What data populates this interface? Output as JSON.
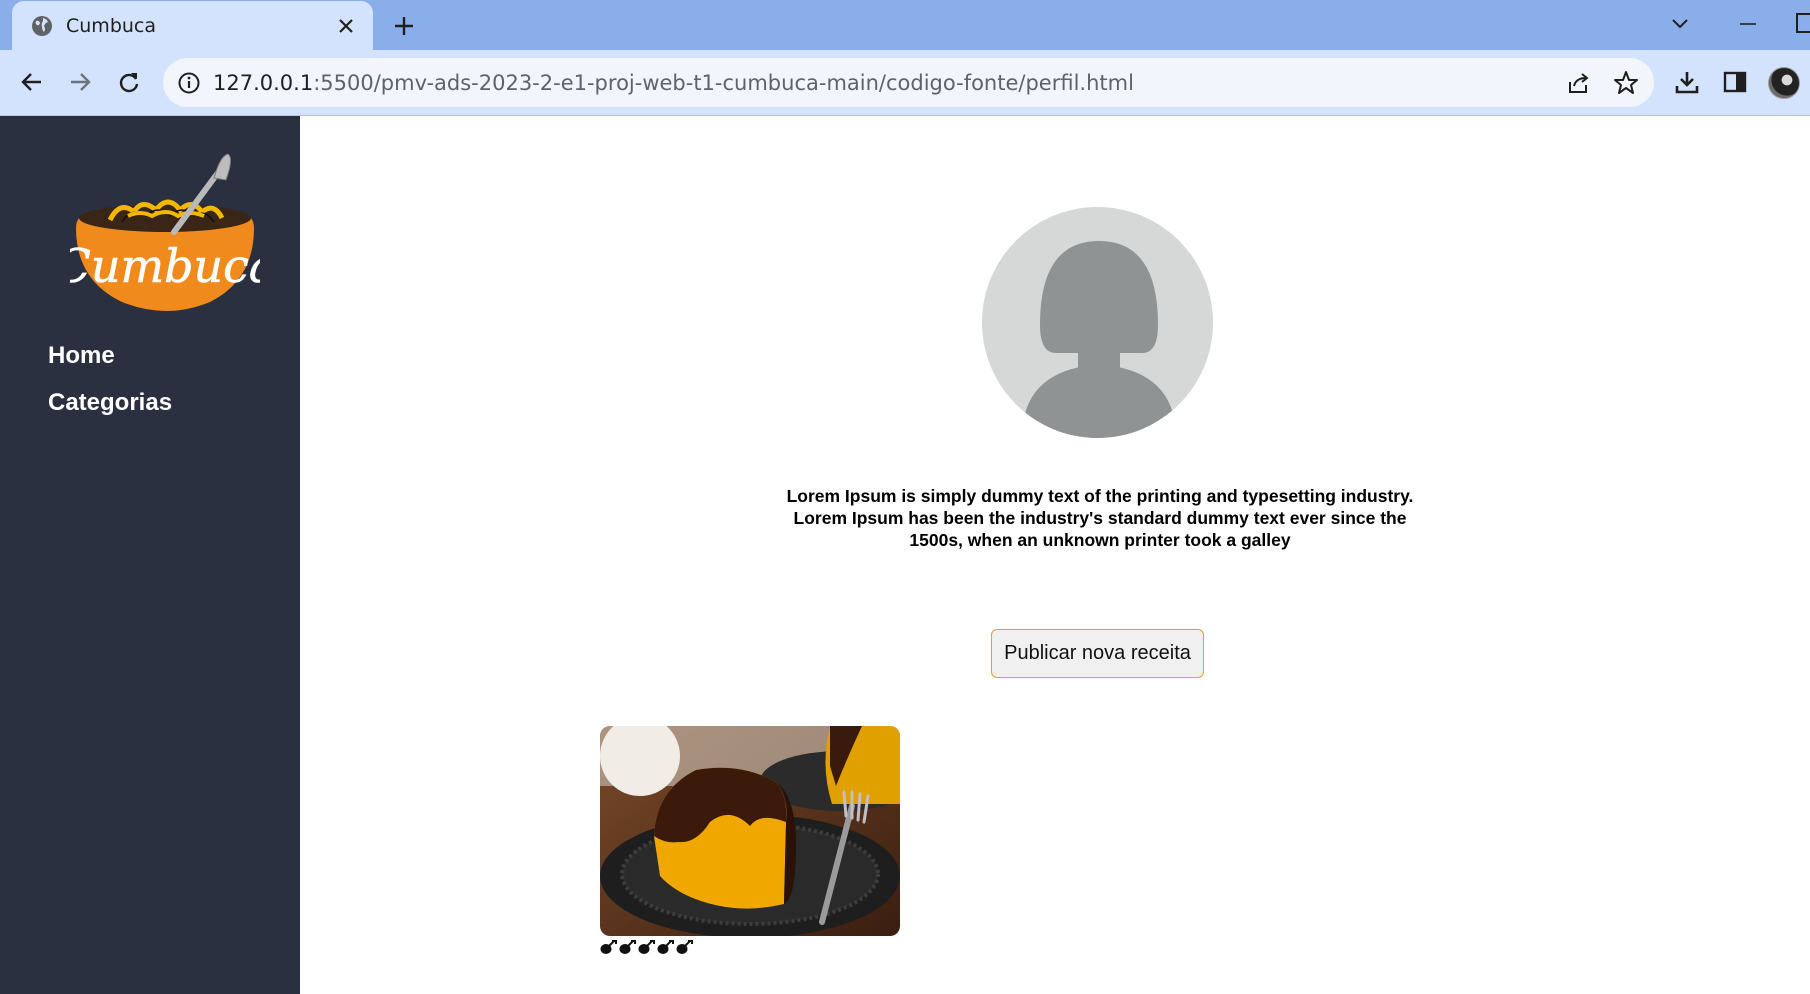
{
  "browser": {
    "tab_title": "Cumbuca",
    "url_host": "127.0.0.1",
    "url_rest": ":5500/pmv-ads-2023-2-e1-proj-web-t1-cumbuca-main/codigo-fonte/perfil.html",
    "icons": {
      "favicon": "globe-icon",
      "close": "close-icon",
      "new_tab": "plus-icon",
      "back": "arrow-left-icon",
      "forward": "arrow-right-icon",
      "reload": "reload-icon",
      "site_info": "info-icon",
      "share": "share-icon",
      "bookmark": "star-icon",
      "downloads": "download-icon",
      "side_panel": "side-panel-icon",
      "tab_search": "chevron-down-icon",
      "minimize": "minimize-icon"
    }
  },
  "sidebar": {
    "logo_text": "Cumbuca",
    "nav": [
      {
        "label": "Home"
      },
      {
        "label": "Categorias"
      }
    ]
  },
  "profile": {
    "bio": "Lorem Ipsum is simply dummy text of the printing and typesetting industry. Lorem Ipsum has been the industry's standard dummy text ever since the 1500s, when an unknown printer took a galley",
    "publish_label": "Publicar nova receita"
  },
  "recipes": [
    {
      "rating": 5,
      "rating_max": 5,
      "image": "chocolate-covered-carrot-cake"
    }
  ],
  "colors": {
    "sidebar_bg": "#2a303f",
    "accent_orange": "#f29a2e",
    "tab_strip": "#8aaee9",
    "toolbar": "#d3e3fd"
  }
}
